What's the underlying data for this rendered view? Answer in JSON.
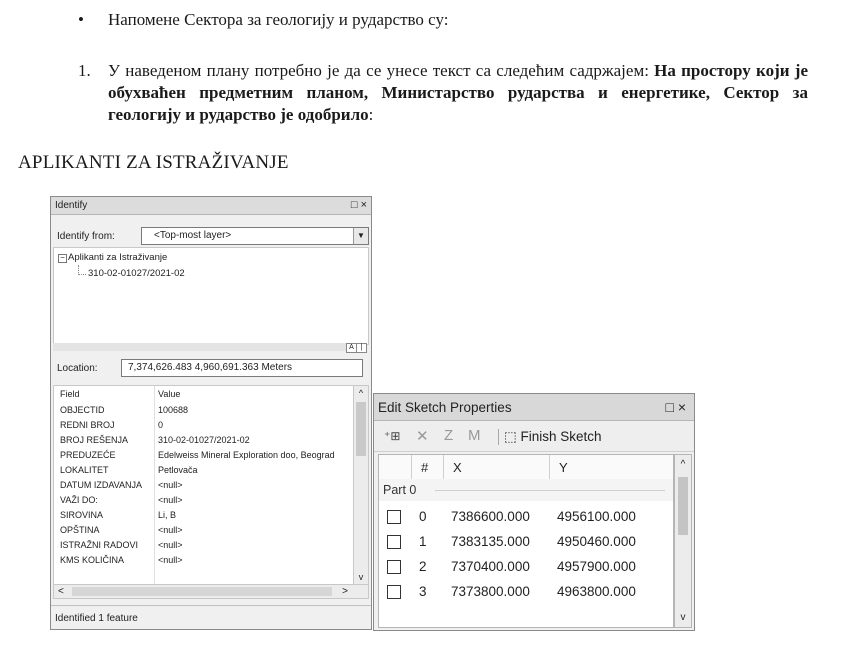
{
  "document": {
    "bullet": "Напомене Сектора за геологију и рударство су:",
    "item_number": "1.",
    "item_text_normal": "У наведеном  плану потребно је да се унесе текст са следећим садржајем: ",
    "item_text_bold": "На простору који је обухваћен предметним планом, Министарство рударства и енергетике, Сектор за геологију и рударство је одобрило",
    "item_text_tail": ":",
    "section_heading": "APLIKANTI ZA ISTRAŽIVANJE"
  },
  "identify": {
    "title": "Identify",
    "title_controls": "□ ×",
    "from_label": "Identify from:",
    "from_value": "<Top-most layer>",
    "tree_layer": "Aplikanti za Istraživanje",
    "tree_feature": "310-02-01027/2021-02",
    "location_label": "Location:",
    "location_value": "7,374,626.483  4,960,691.363 Meters",
    "fields_header": {
      "field": "Field",
      "value": "Value"
    },
    "fields": [
      {
        "name": "OBJECTID",
        "value": "100688"
      },
      {
        "name": "REDNI BROJ",
        "value": "0"
      },
      {
        "name": "BROJ REŠENJA",
        "value": "310-02-01027/2021-02"
      },
      {
        "name": "PREDUZEĆE",
        "value": "Edelweiss Mineral Exploration doo, Beograd"
      },
      {
        "name": "LOKALITET",
        "value": "Petlovača"
      },
      {
        "name": "DATUM IZDAVANJA",
        "value": "<null>"
      },
      {
        "name": "VAŽI DO:",
        "value": "<null>"
      },
      {
        "name": "SIROVINA",
        "value": "Li, B"
      },
      {
        "name": "OPŠTINA",
        "value": "<null>"
      },
      {
        "name": "ISTRAŽNI RADOVI",
        "value": "<null>"
      },
      {
        "name": "KMS KOLIČINA",
        "value": "<null>"
      }
    ],
    "status": "Identified 1 feature"
  },
  "sketch": {
    "title": "Edit Sketch Properties",
    "title_controls": "□ ×",
    "finish_label": "Finish Sketch",
    "columns": {
      "num": "#",
      "x": "X",
      "y": "Y"
    },
    "part_label": "Part 0",
    "vertices": [
      {
        "idx": "0",
        "x": "7386600.000",
        "y": "4956100.000"
      },
      {
        "idx": "1",
        "x": "7383135.000",
        "y": "4950460.000"
      },
      {
        "idx": "2",
        "x": "7370400.000",
        "y": "4957900.000"
      },
      {
        "idx": "3",
        "x": "7373800.000",
        "y": "4963800.000"
      }
    ]
  }
}
